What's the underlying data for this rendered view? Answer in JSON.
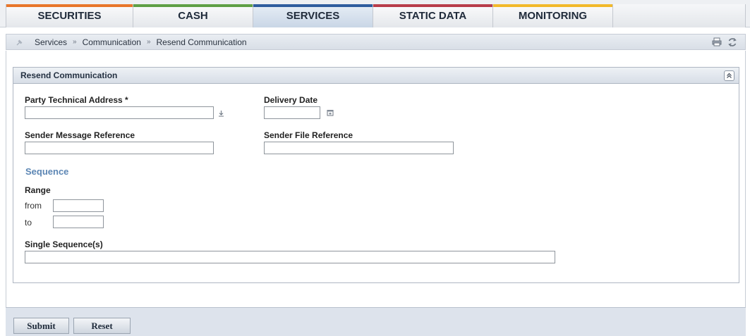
{
  "tabs": [
    {
      "label": "SECURITIES",
      "color": "#e8762a"
    },
    {
      "label": "CASH",
      "color": "#5fa046"
    },
    {
      "label": "SERVICES",
      "color": "#2f5d9e"
    },
    {
      "label": "STATIC DATA",
      "color": "#b83c4a"
    },
    {
      "label": "MONITORING",
      "color": "#f2b92b"
    }
  ],
  "active_tab": "SERVICES",
  "breadcrumb": {
    "items": [
      "Services",
      "Communication",
      "Resend Communication"
    ],
    "separator": "»"
  },
  "panel": {
    "title": "Resend Communication",
    "fields": {
      "party_technical_address": {
        "label": "Party Technical Address *",
        "value": ""
      },
      "delivery_date": {
        "label": "Delivery Date",
        "value": ""
      },
      "sender_message_reference": {
        "label": "Sender Message Reference",
        "value": ""
      },
      "sender_file_reference": {
        "label": "Sender File Reference",
        "value": ""
      }
    },
    "sequence": {
      "title": "Sequence",
      "range_label": "Range",
      "from_label": "from",
      "to_label": "to",
      "from_value": "",
      "to_value": "",
      "single_label": "Single Sequence(s)",
      "single_value": ""
    }
  },
  "footer": {
    "submit_label": "Submit",
    "reset_label": "Reset"
  },
  "icons": {
    "pin": "pin-icon",
    "print": "print-icon",
    "refresh": "refresh-icon",
    "collapse": "chevron-double-up-icon",
    "search": "download-arrow-icon",
    "calendar": "calendar-icon"
  }
}
